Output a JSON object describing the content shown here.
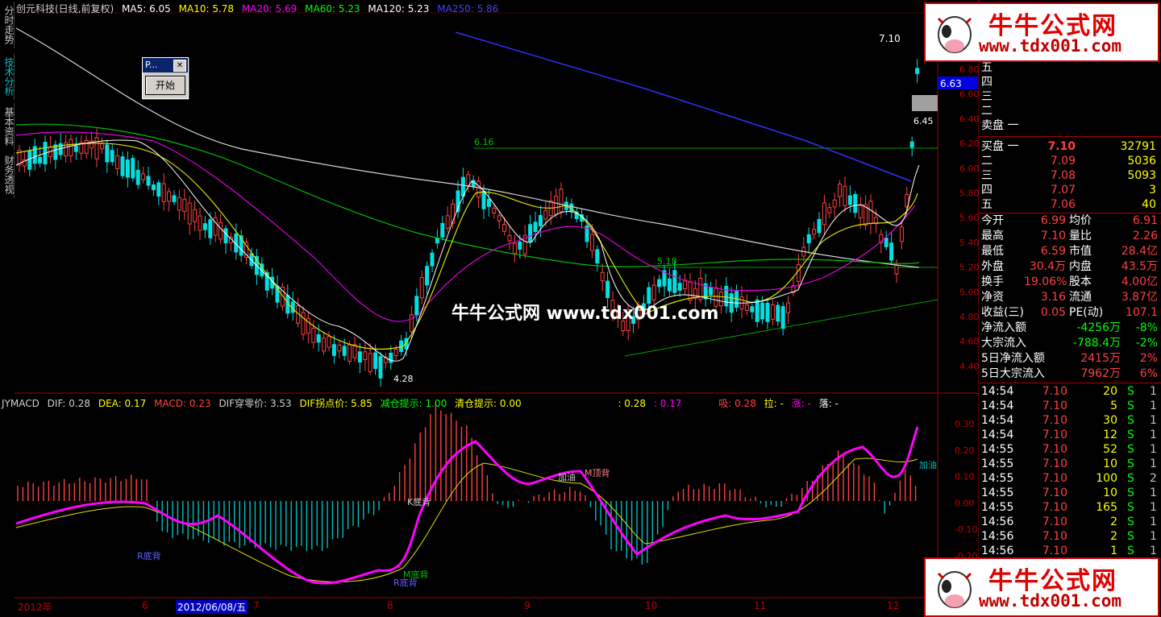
{
  "header": {
    "stock": "创元科技(日线,前复权)",
    "ma5": "MA5: 6.05",
    "ma10": "MA10: 5.78",
    "ma20": "MA20: 5.69",
    "ma60": "MA60: 5.23",
    "ma120": "MA120: 5.23",
    "ma250": "MA250: 5.86",
    "colors": {
      "ma5": "#ffffff",
      "ma10": "#ffff00",
      "ma20": "#ff00ff",
      "ma60": "#00ff00",
      "ma120": "#ffffff",
      "ma250": "#0000ff"
    }
  },
  "side_tabs": [
    "分时走势",
    "技术分析",
    "基本资料",
    "财务透视"
  ],
  "dialog": {
    "title": "P...",
    "button": "开始"
  },
  "center_watermark": "牛牛公式网 www.tdx001.com",
  "watermark": {
    "title": "牛牛公式网",
    "url": "www.tdx001.com"
  },
  "price_axis": [
    "6.80",
    "6.60",
    "6.40",
    "6.20",
    "6.00",
    "5.80",
    "5.60",
    "5.40",
    "5.20",
    "5.00",
    "4.80",
    "4.60",
    "4.40"
  ],
  "price_labels": {
    "high": "7.10",
    "current": "6.63",
    "marker": "6.45",
    "level1": "6.16",
    "level2": "5.18",
    "low": "4.28"
  },
  "macd_header": {
    "name": "JYMACD",
    "dif": "DIF: 0.28",
    "dea": "DEA: 0.17",
    "macd": "MACD: 0.23",
    "cross": "DIF穿零价: 3.53",
    "turn": "DIF拐点价: 5.85",
    "reduce": "减仓提示: 1.00",
    "clear": "清仓提示: 0.00",
    "v1": ": 0.28",
    "v2": ": 0.17",
    "xi": "吸: 0.28",
    "la": "拉: -",
    "zhang": "涨: -",
    "luo": "落: -"
  },
  "macd_axis": [
    "0.30",
    "0.20",
    "0.10",
    "0.00",
    "-0.10",
    "-0.20",
    "-0.30"
  ],
  "macd_annotations": [
    "R底背",
    "R底背",
    "K底背",
    "M底背",
    "加油",
    "M顶背",
    "加油"
  ],
  "x_axis": [
    "2012年",
    "6",
    "2012/06/08/五",
    "7",
    "8",
    "9",
    "10",
    "11",
    "12"
  ],
  "order_book": {
    "sell": [
      {
        "label": "五",
        "price": "",
        "vol": ""
      },
      {
        "label": "四",
        "price": "",
        "vol": ""
      },
      {
        "label": "三",
        "price": "",
        "vol": ""
      },
      {
        "label": "二",
        "price": "",
        "vol": ""
      },
      {
        "label": "卖盘 一",
        "price": "",
        "vol": ""
      }
    ],
    "buy": [
      {
        "label": "买盘 一",
        "price": "7.10",
        "vol": "32791"
      },
      {
        "label": "二",
        "price": "7.09",
        "vol": "5036"
      },
      {
        "label": "三",
        "price": "7.08",
        "vol": "5093"
      },
      {
        "label": "四",
        "price": "7.07",
        "vol": "3"
      },
      {
        "label": "五",
        "price": "7.06",
        "vol": "40"
      }
    ]
  },
  "quote": [
    {
      "k1": "今开",
      "v1": "6.99",
      "k2": "均价",
      "v2": "6.91"
    },
    {
      "k1": "最高",
      "v1": "7.10",
      "k2": "量比",
      "v2": "2.26"
    },
    {
      "k1": "最低",
      "v1": "6.59",
      "k2": "市值",
      "v2": "28.4亿"
    },
    {
      "k1": "外盘",
      "v1": "30.4万",
      "k2": "内盘",
      "v2": "43.5万"
    },
    {
      "k1": "换手",
      "v1": "19.06%",
      "k2": "股本",
      "v2": "4.00亿"
    },
    {
      "k1": "净资",
      "v1": "3.16",
      "k2": "流通",
      "v2": "3.87亿"
    },
    {
      "k1": "收益(三)",
      "v1": "0.05",
      "k2": "PE(动)",
      "v2": "107.1"
    }
  ],
  "flows": [
    {
      "label": "净流入额",
      "value": "-4256万",
      "pct": "-8%"
    },
    {
      "label": "大宗流入",
      "value": "-788.4万",
      "pct": "-2%"
    },
    {
      "label": "5日净流入额",
      "value": "2415万",
      "pct": "2%"
    },
    {
      "label": "5日大宗流入",
      "value": "7962万",
      "pct": "6%"
    }
  ],
  "ticks": [
    {
      "time": "14:54",
      "price": "7.10",
      "vol": "20",
      "side": "S",
      "n": "1"
    },
    {
      "time": "14:54",
      "price": "7.10",
      "vol": "5",
      "side": "S",
      "n": "1"
    },
    {
      "time": "14:54",
      "price": "7.10",
      "vol": "30",
      "side": "S",
      "n": "1"
    },
    {
      "time": "14:54",
      "price": "7.10",
      "vol": "12",
      "side": "S",
      "n": "1"
    },
    {
      "time": "14:55",
      "price": "7.10",
      "vol": "52",
      "side": "S",
      "n": "1"
    },
    {
      "time": "14:55",
      "price": "7.10",
      "vol": "10",
      "side": "S",
      "n": "1"
    },
    {
      "time": "14:55",
      "price": "7.10",
      "vol": "100",
      "side": "S",
      "n": "2"
    },
    {
      "time": "14:55",
      "price": "7.10",
      "vol": "10",
      "side": "S",
      "n": "1"
    },
    {
      "time": "14:55",
      "price": "7.10",
      "vol": "165",
      "side": "S",
      "n": "1"
    },
    {
      "time": "14:56",
      "price": "7.10",
      "vol": "2",
      "side": "S",
      "n": "1"
    },
    {
      "time": "14:56",
      "price": "7.10",
      "vol": "2",
      "side": "S",
      "n": "1"
    },
    {
      "time": "14:56",
      "price": "7.10",
      "vol": "1",
      "side": "S",
      "n": "1"
    }
  ]
}
